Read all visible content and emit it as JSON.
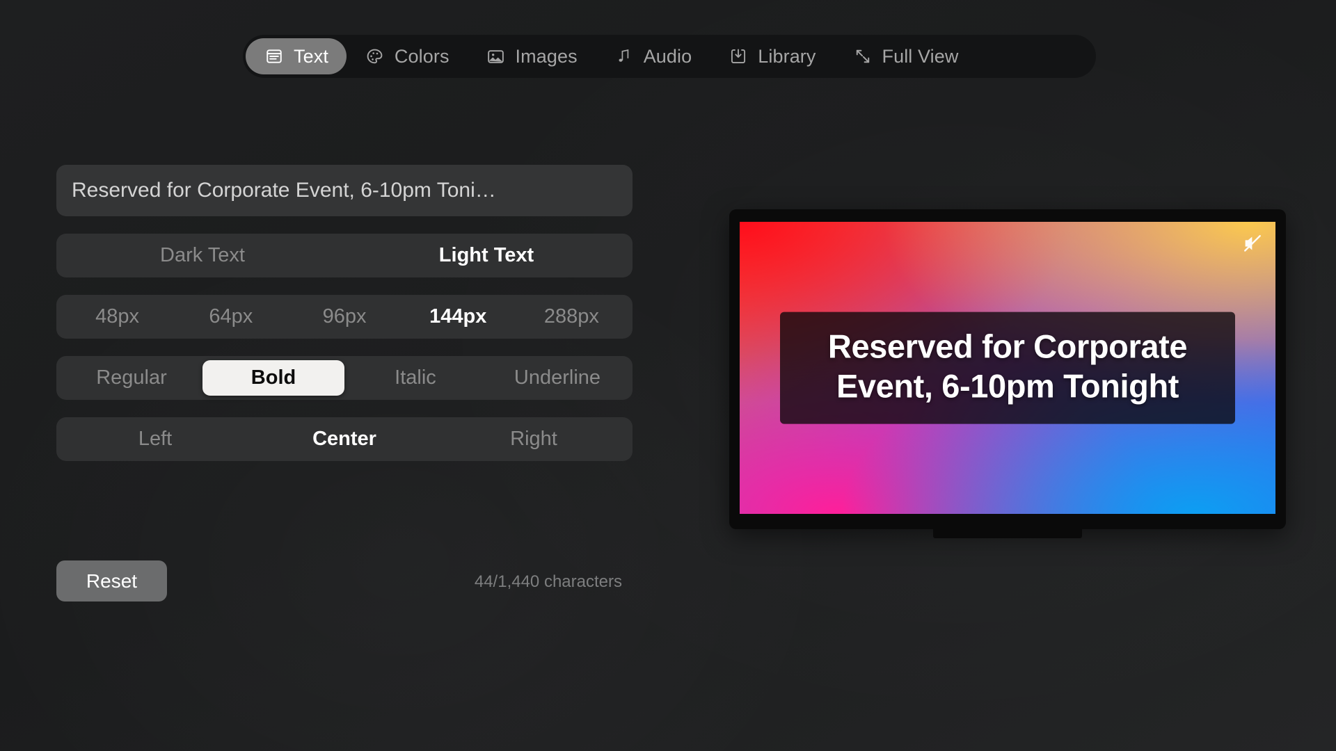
{
  "tabs": [
    {
      "id": "text",
      "label": "Text",
      "icon": "document-text-icon",
      "active": true
    },
    {
      "id": "colors",
      "label": "Colors",
      "icon": "palette-icon",
      "active": false
    },
    {
      "id": "images",
      "label": "Images",
      "icon": "photo-icon",
      "active": false
    },
    {
      "id": "audio",
      "label": "Audio",
      "icon": "music-note-icon",
      "active": false
    },
    {
      "id": "library",
      "label": "Library",
      "icon": "download-box-icon",
      "active": false
    },
    {
      "id": "full_view",
      "label": "Full View",
      "icon": "expand-arrows-icon",
      "active": false
    }
  ],
  "editor": {
    "message_input": {
      "value": "Reserved for Corporate Event, 6-10pm Toni…",
      "placeholder": "Enter your message"
    },
    "theme": {
      "options": [
        "Dark Text",
        "Light Text"
      ],
      "selected": "Light Text"
    },
    "size": {
      "options": [
        "48px",
        "64px",
        "96px",
        "144px",
        "288px"
      ],
      "selected": "144px"
    },
    "style": {
      "options": [
        "Regular",
        "Bold",
        "Italic",
        "Underline"
      ],
      "selected": "Bold"
    },
    "align": {
      "options": [
        "Left",
        "Center",
        "Right"
      ],
      "selected": "Center"
    },
    "reset_label": "Reset",
    "character_count": "44/1,440 characters"
  },
  "preview": {
    "overlay_text": "Reserved for Corporate Event, 6-10pm Tonight",
    "muted": true,
    "mute_icon": "speaker-muted-icon",
    "gradient": {
      "top_left": "#ff0d1c",
      "top_right": "#fbc94e",
      "bottom_left": "#ff1f9a",
      "bottom_right": "#0d9ef2",
      "center": "#a150c8"
    }
  },
  "colors": {
    "background": "#1b1c1d",
    "tabbar_background": "#131415",
    "tab_active_pill": "#7b7b7b",
    "field_background": "#343536",
    "segment_background": "#303132",
    "pressed_pill": "#f2f1ef",
    "reset_button": "#6b6c6d",
    "muted_text": "#8b8b8b",
    "selected_text": "#ffffff"
  }
}
